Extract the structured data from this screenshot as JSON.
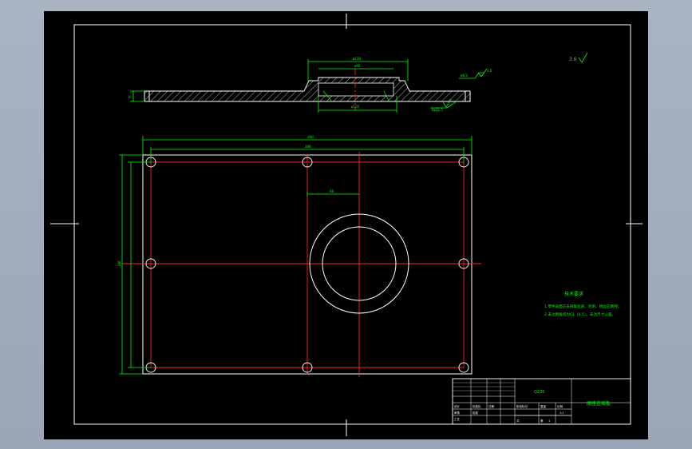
{
  "drawing": {
    "background_color": "#000000",
    "frame_color": "#ffffff",
    "dimension_color": "#00ff00",
    "centerline_color": "#ff2020",
    "roughness_symbol": "3.6",
    "dim_overall_width": "300",
    "dim_hole_spacing": "288",
    "dim_center_offset": "46",
    "dim_height": "186",
    "dim_bore_top": "ø130",
    "dim_bore_mid": "ø95",
    "dim_bore_bottom": "ø120",
    "dim_thickness": "8",
    "dim_hub": "ø8.3",
    "dim_hole_callout": "8ø12.5"
  },
  "notes": {
    "heading": "技术要求",
    "line1": "1.零件表面应去除氧化皮、毛刺、锐边应倒钝；",
    "line2": "2.未注倒角均为C1（0.5）。未注尺寸公差。"
  },
  "title_block": {
    "part_name": "底座连接板",
    "material": "Q235",
    "scale": "1:1",
    "sheet": "1",
    "label_designer": "设计",
    "label_checker": "审核",
    "label_stage": "阶段标记",
    "label_weight": "重量",
    "label_scale": "比例",
    "label_total": "共",
    "label_sheet": "第",
    "label_standard": "标准化",
    "label_date": "日期",
    "label_process": "工艺",
    "label_approve": "批准"
  }
}
